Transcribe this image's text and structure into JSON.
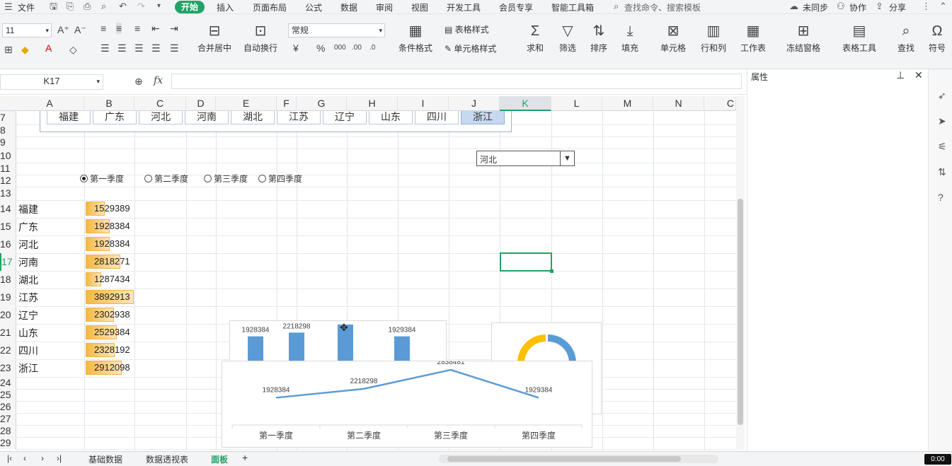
{
  "menu": {
    "file": "文件",
    "tabs": [
      "开始",
      "插入",
      "页面布局",
      "公式",
      "数据",
      "审阅",
      "视图",
      "开发工具",
      "会员专享",
      "智能工具箱"
    ],
    "search_placeholder": "查找命令、搜索模板",
    "sync": "未同步",
    "collab": "协作",
    "share": "分享"
  },
  "ribbon": {
    "font_size": "11",
    "number_format": "常规",
    "merge": "合并居中",
    "wrap": "自动换行",
    "cond_format": "条件格式",
    "table_style": "表格样式",
    "cell_style": "单元格样式",
    "sum": "求和",
    "filter": "筛选",
    "sort": "排序",
    "fill": "填充",
    "cell": "单元格",
    "rowcol": "行和列",
    "worksheet": "工作表",
    "freeze": "冻结窗格",
    "table_tools": "表格工具",
    "find": "查找",
    "symbol": "符号"
  },
  "formula_bar": {
    "name_box": "K17",
    "fx": "fx",
    "formula": ""
  },
  "panel": {
    "title": "属性"
  },
  "columns": [
    "A",
    "B",
    "C",
    "D",
    "E",
    "F",
    "G",
    "H",
    "I",
    "J",
    "K",
    "L",
    "M",
    "N",
    "C"
  ],
  "rows": [
    "7",
    "8",
    "9",
    "10",
    "11",
    "12",
    "13",
    "14",
    "15",
    "16",
    "17",
    "18",
    "19",
    "20",
    "21",
    "22",
    "23",
    "24",
    "25",
    "26",
    "27",
    "28",
    "29"
  ],
  "slicer": [
    "福建",
    "广东",
    "河北",
    "河南",
    "湖北",
    "江苏",
    "辽宁",
    "山东",
    "四川",
    "浙江"
  ],
  "dropdown_value": "河北",
  "radios": [
    "第一季度",
    "第二季度",
    "第三季度",
    "第四季度"
  ],
  "table": [
    {
      "province": "福建",
      "value": "1529389",
      "ratio": 0.39
    },
    {
      "province": "广东",
      "value": "1928384",
      "ratio": 0.5
    },
    {
      "province": "河北",
      "value": "1928384",
      "ratio": 0.5
    },
    {
      "province": "河南",
      "value": "2818271",
      "ratio": 0.72
    },
    {
      "province": "湖北",
      "value": "1287434",
      "ratio": 0.33
    },
    {
      "province": "江苏",
      "value": "3892913",
      "ratio": 1.0
    },
    {
      "province": "辽宁",
      "value": "2302938",
      "ratio": 0.59
    },
    {
      "province": "山东",
      "value": "2529384",
      "ratio": 0.65
    },
    {
      "province": "四川",
      "value": "2328192",
      "ratio": 0.6
    },
    {
      "province": "浙江",
      "value": "2912098",
      "ratio": 0.75
    }
  ],
  "chart_data": [
    {
      "type": "bar",
      "values": [
        1928384,
        2218298,
        2838481,
        1929384
      ],
      "labels": [
        "1928384",
        "2218298",
        "2838481",
        "1929384"
      ],
      "color": "#5b9bd5"
    },
    {
      "type": "line",
      "categories": [
        "第一季度",
        "第二季度",
        "第三季度",
        "第四季度"
      ],
      "values": [
        1928384,
        2218298,
        2838481,
        1929384
      ],
      "labels": [
        "1928384",
        "2218298",
        "2838481",
        "1929384"
      ],
      "color": "#5b9bd5"
    },
    {
      "type": "pie",
      "colors": [
        "#ffc000",
        "#5b9bd5"
      ]
    }
  ],
  "sheet_tabs": [
    "基础数据",
    "数据透视表",
    "面板"
  ],
  "zoom": "0:00"
}
